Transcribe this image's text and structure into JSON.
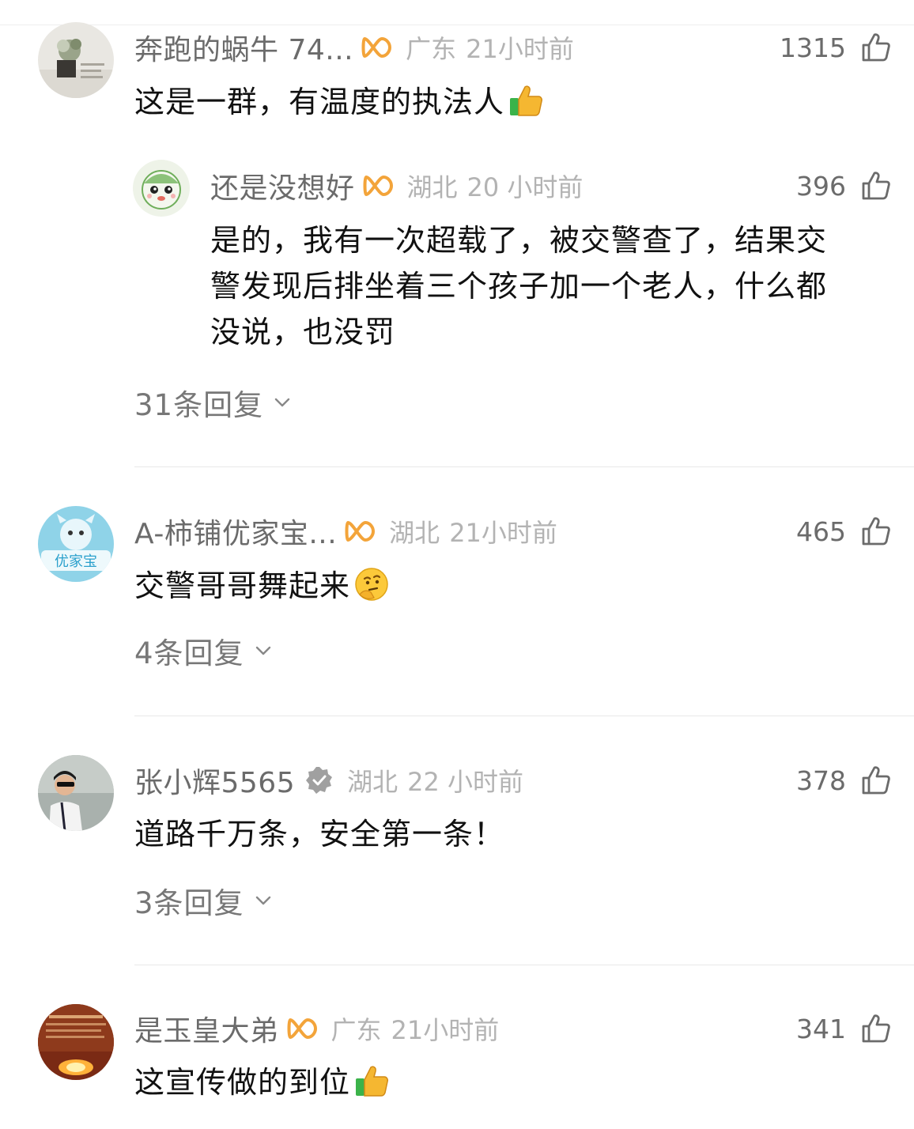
{
  "comments": [
    {
      "username": "奔跑的蜗牛 74...",
      "location": "广东",
      "time": "21小时前",
      "likes": "1315",
      "text": "这是一群，有温度的执法人",
      "emoji": "thumbs-up",
      "badge": "member",
      "sub_reply": {
        "username": "还是没想好",
        "location": "湖北",
        "time": "20 小时前",
        "likes": "396",
        "text_line1": "是的，我有一次超载了，被交警查了，结果交",
        "text_line2": "警发现后排坐着三个孩子加一个老人，什么都",
        "text_line3": "没说，也没罚",
        "badge": "member"
      },
      "replies_label": "31条回复"
    },
    {
      "username": "A-柿铺优家宝...",
      "location": "湖北",
      "time": "21小时前",
      "likes": "465",
      "text": "交警哥哥舞起来",
      "emoji": "thinking-face",
      "badge": "member",
      "replies_label": "4条回复"
    },
    {
      "username": "张小辉5565",
      "location": "湖北",
      "time": "22 小时前",
      "likes": "378",
      "text": "道路千万条，安全第一条！",
      "badge": "verified",
      "replies_label": "3条回复"
    },
    {
      "username": "是玉皇大弟",
      "location": "广东",
      "time": "21小时前",
      "likes": "341",
      "text": "这宣传做的到位",
      "emoji": "thumbs-up",
      "badge": "member"
    }
  ],
  "colors": {
    "member_badge": "#f3a43a",
    "verified_badge": "#a0a0a0",
    "meta_text": "#b3b3b3",
    "username_text": "#6b6b6b"
  }
}
